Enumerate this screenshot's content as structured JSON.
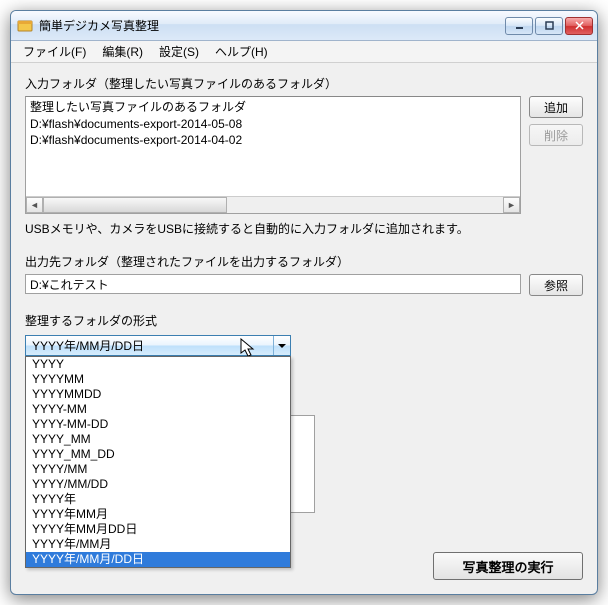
{
  "window": {
    "title": "簡単デジカメ写真整理"
  },
  "menu": {
    "file": "ファイル(F)",
    "edit": "編集(R)",
    "settings": "設定(S)",
    "help": "ヘルプ(H)"
  },
  "input_section": {
    "label": "入力フォルダ（整理したい写真ファイルのあるフォルダ）",
    "items": [
      "整理したい写真ファイルのあるフォルダ",
      "D:¥flash¥documents-export-2014-05-08",
      "D:¥flash¥documents-export-2014-04-02"
    ],
    "add": "追加",
    "del": "削除",
    "note": "USBメモリや、カメラをUSBに接続すると自動的に入力フォルダに追加されます。"
  },
  "output_section": {
    "label": "出力先フォルダ（整理されたファイルを出力するフォルダ）",
    "value": "D:¥これテスト",
    "browse": "参照"
  },
  "format_section": {
    "label": "整理するフォルダの形式",
    "selected": "YYYY年/MM月/DD日",
    "options": [
      "YYYY",
      "YYYYMM",
      "YYYYMMDD",
      "YYYY-MM",
      "YYYY-MM-DD",
      "YYYY_MM",
      "YYYY_MM_DD",
      "YYYY/MM",
      "YYYY/MM/DD",
      "YYYY年",
      "YYYY年MM月",
      "YYYY年MM月DD日",
      "YYYY年/MM月",
      "YYYY年/MM月/DD日"
    ]
  },
  "run": "写真整理の実行"
}
